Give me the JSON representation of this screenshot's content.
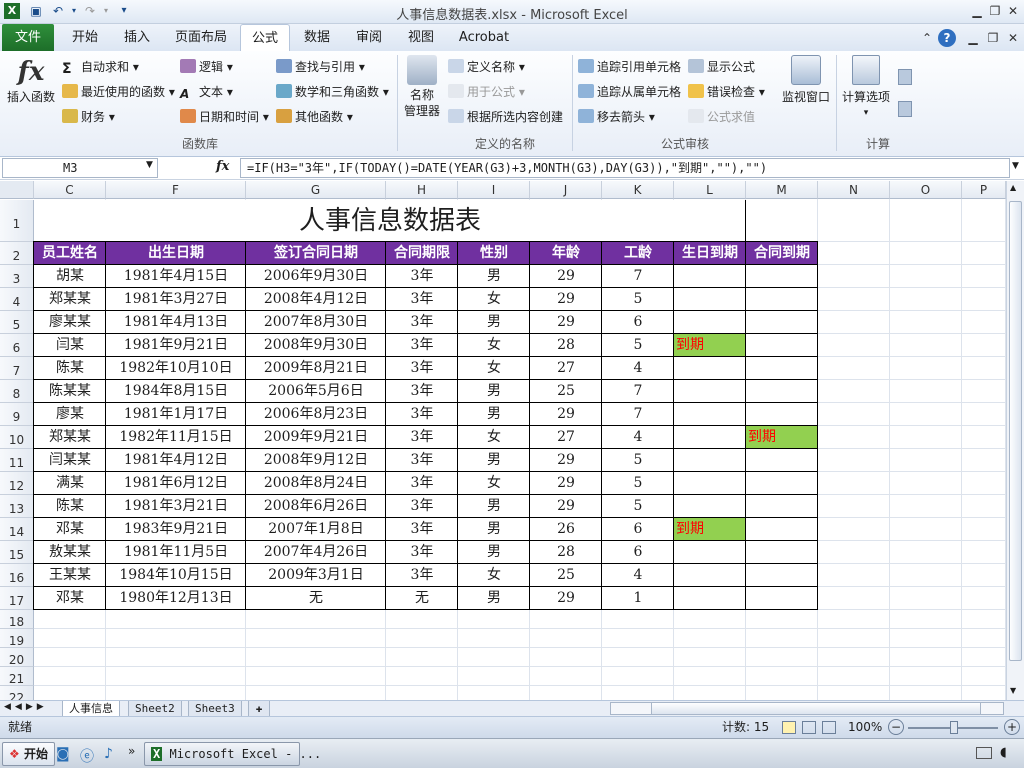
{
  "window": {
    "title": "人事信息数据表.xlsx - Microsoft Excel"
  },
  "tabs": [
    "文件",
    "开始",
    "插入",
    "页面布局",
    "公式",
    "数据",
    "审阅",
    "视图",
    "Acrobat"
  ],
  "ribbon": {
    "insert_function": "插入函数",
    "autosum": "自动求和",
    "recent": "最近使用的函数",
    "finance": "财务",
    "logic": "逻辑",
    "text": "文本",
    "datetime": "日期和时间",
    "lookup": "查找与引用",
    "math": "数学和三角函数",
    "other": "其他函数",
    "group_library": "函数库",
    "name_manager_1": "名称",
    "name_manager_2": "管理器",
    "define_name": "定义名称",
    "use_in_formula": "用于公式",
    "create_from_sel": "根据所选内容创建",
    "group_names": "定义的名称",
    "trace_precedents": "追踪引用单元格",
    "trace_dependents": "追踪从属单元格",
    "remove_arrows": "移去箭头",
    "show_formulas": "显示公式",
    "error_check": "错误检查",
    "evaluate": "公式求值",
    "watch": "监视窗口",
    "group_audit": "公式审核",
    "calc_options": "计算选项",
    "group_calc": "计算"
  },
  "formula_bar": {
    "name_box": "M3",
    "fx": "fx",
    "formula": "=IF(H3=\"3年\",IF(TODAY()=DATE(YEAR(G3)+3,MONTH(G3),DAY(G3)),\"到期\",\"\"),\"\")"
  },
  "columns": [
    "C",
    "F",
    "G",
    "H",
    "I",
    "J",
    "K",
    "L",
    "M",
    "N",
    "O",
    "P"
  ],
  "rows": [
    "1",
    "2",
    "3",
    "4",
    "5",
    "6",
    "7",
    "8",
    "9",
    "10",
    "11",
    "12",
    "13",
    "14",
    "15",
    "16",
    "17",
    "18",
    "19",
    "20",
    "21",
    "22"
  ],
  "sheet": {
    "title": "人事信息数据表",
    "headers": [
      "员工姓名",
      "出生日期",
      "签订合同日期",
      "合同期限",
      "性别",
      "年龄",
      "工龄",
      "生日到期",
      "合同到期"
    ],
    "data": [
      [
        "胡某",
        "1981年4月15日",
        "2006年9月30日",
        "3年",
        "男",
        "29",
        "7",
        "",
        ""
      ],
      [
        "郑某某",
        "1981年3月27日",
        "2008年4月12日",
        "3年",
        "女",
        "29",
        "5",
        "",
        ""
      ],
      [
        "廖某某",
        "1981年4月13日",
        "2007年8月30日",
        "3年",
        "男",
        "29",
        "6",
        "",
        ""
      ],
      [
        "闫某",
        "1981年9月21日",
        "2008年9月30日",
        "3年",
        "女",
        "28",
        "5",
        "到期",
        ""
      ],
      [
        "陈某",
        "1982年10月10日",
        "2009年8月21日",
        "3年",
        "女",
        "27",
        "4",
        "",
        ""
      ],
      [
        "陈某某",
        "1984年8月15日",
        "2006年5月6日",
        "3年",
        "男",
        "25",
        "7",
        "",
        ""
      ],
      [
        "廖某",
        "1981年1月17日",
        "2006年8月23日",
        "3年",
        "男",
        "29",
        "7",
        "",
        ""
      ],
      [
        "郑某某",
        "1982年11月15日",
        "2009年9月21日",
        "3年",
        "女",
        "27",
        "4",
        "",
        "到期"
      ],
      [
        "闫某某",
        "1981年4月12日",
        "2008年9月12日",
        "3年",
        "男",
        "29",
        "5",
        "",
        ""
      ],
      [
        "满某",
        "1981年6月12日",
        "2008年8月24日",
        "3年",
        "女",
        "29",
        "5",
        "",
        ""
      ],
      [
        "陈某",
        "1981年3月21日",
        "2008年6月26日",
        "3年",
        "男",
        "29",
        "5",
        "",
        ""
      ],
      [
        "邓某",
        "1983年9月21日",
        "2007年1月8日",
        "3年",
        "男",
        "26",
        "6",
        "到期",
        ""
      ],
      [
        "敖某某",
        "1981年11月5日",
        "2007年4月26日",
        "3年",
        "男",
        "28",
        "6",
        "",
        ""
      ],
      [
        "王某某",
        "1984年10月15日",
        "2009年3月1日",
        "3年",
        "女",
        "25",
        "4",
        "",
        ""
      ],
      [
        "邓某",
        "1980年12月13日",
        "无",
        "无",
        "男",
        "29",
        "1",
        "",
        ""
      ]
    ]
  },
  "sheet_tabs": [
    "人事信息",
    "Sheet2",
    "Sheet3"
  ],
  "status": {
    "ready": "就绪",
    "count": "计数: 15",
    "zoom": "100%"
  },
  "taskbar": {
    "start": "开始",
    "app": "Microsoft Excel - ..."
  },
  "colors": {
    "header_bg": "#7030a0",
    "due_bg": "#92d050",
    "due_text": "#ff0000"
  }
}
